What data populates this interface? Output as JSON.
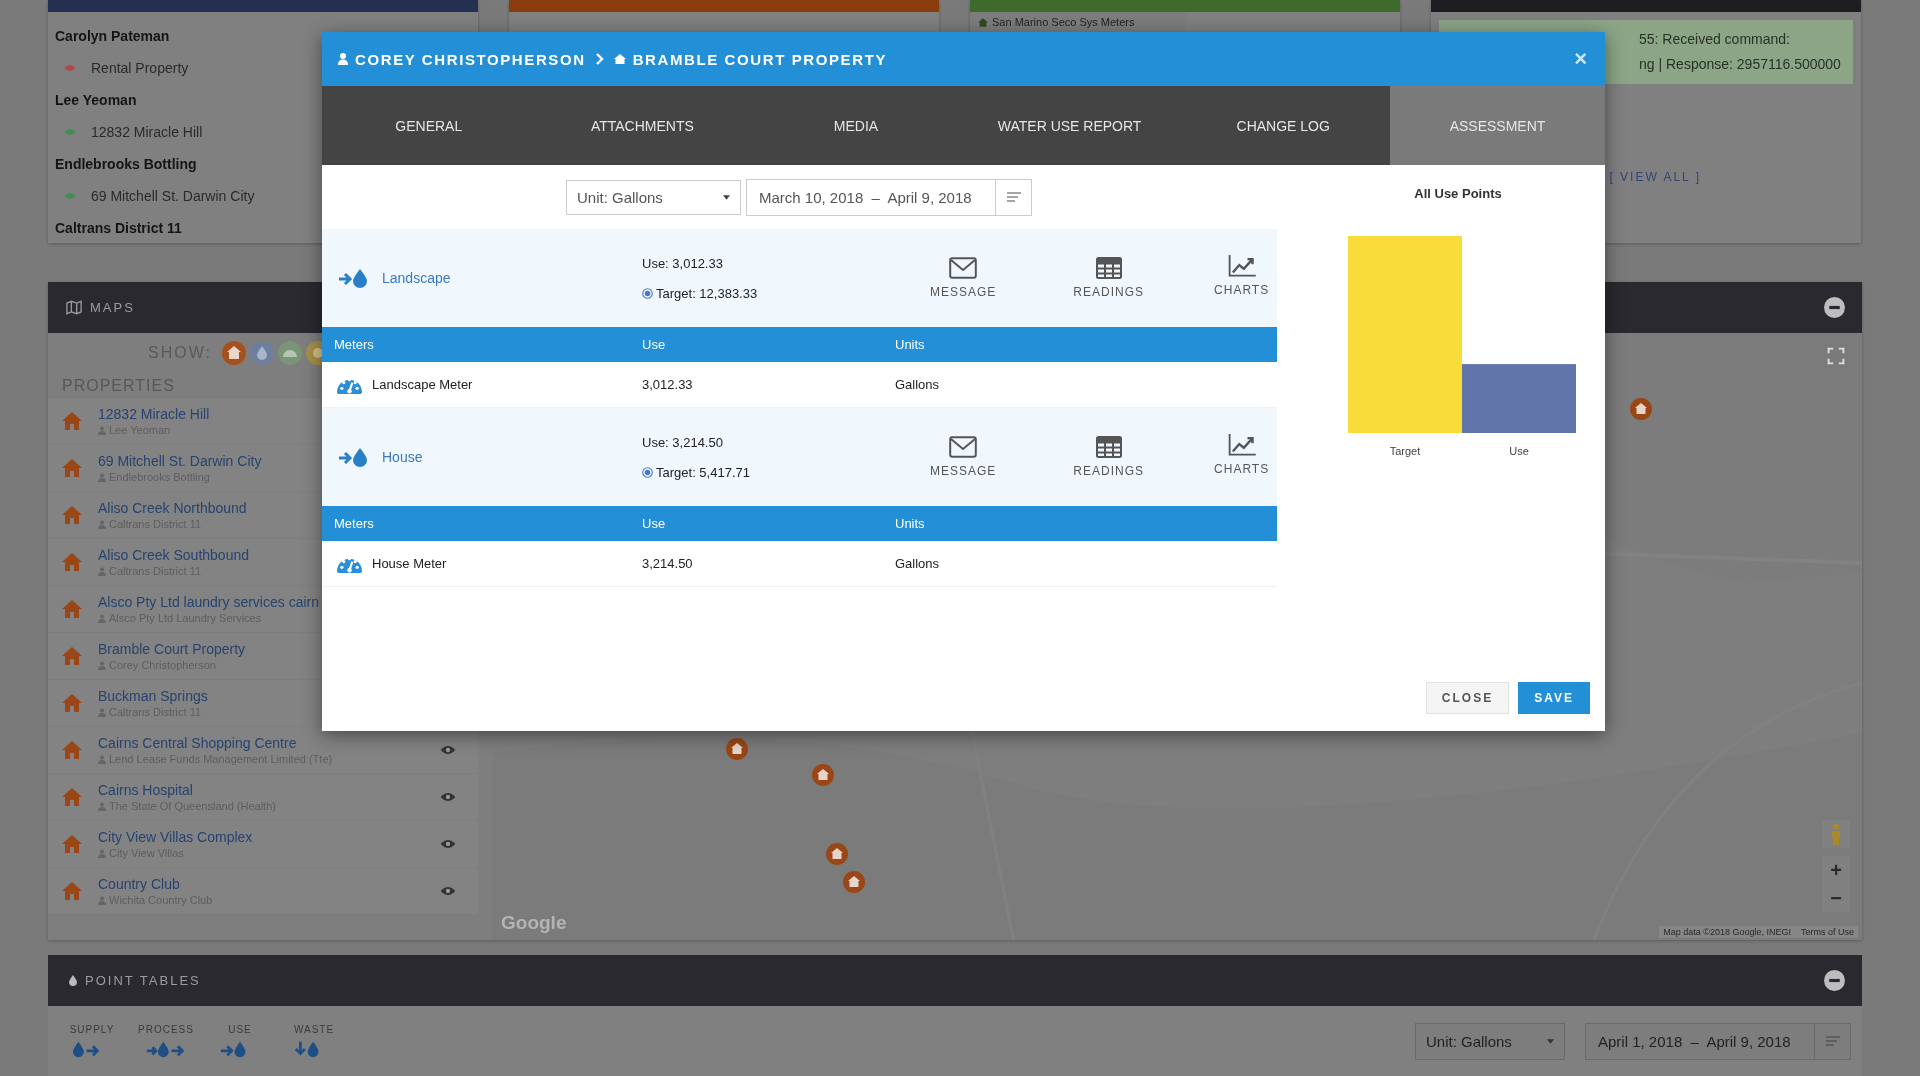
{
  "select_property": {
    "groups": [
      {
        "owner": "Carolyn Pateman",
        "properties": [
          {
            "name": "Rental Property",
            "color": "#b04848"
          }
        ]
      },
      {
        "owner": "Lee Yeoman",
        "properties": [
          {
            "name": "12832 Miracle Hill",
            "color": "#3f8f4f"
          }
        ]
      },
      {
        "owner": "Endlebrooks Bottling",
        "properties": [
          {
            "name": "69 Mitchell St. Darwin City",
            "color": "#3f8f4f"
          }
        ]
      },
      {
        "owner": "Caltrans District 11"
      }
    ]
  },
  "comparisons": {
    "items": [
      "San Marino Seco Sys Meters"
    ]
  },
  "notifications": {
    "lines": [
      "55: Received command:",
      "ng | Response: 2957116.500000"
    ],
    "view_all": "[ VIEW ALL ]"
  },
  "maps": {
    "title": "MAPS",
    "show_label": "SHOW:",
    "filters": [
      {
        "kind": "house",
        "color": "#a8501c"
      },
      {
        "kind": "drop",
        "color": "#6d7f9c"
      },
      {
        "kind": "gauge",
        "color": "#7a9478"
      },
      {
        "kind": "sun",
        "color": "#a89048"
      }
    ],
    "properties_label": "PROPERTIES",
    "properties": [
      {
        "name": "12832 Miracle Hill",
        "owner": "Lee Yeoman",
        "eye": false
      },
      {
        "name": "69 Mitchell St. Darwin City",
        "owner": "Endlebrooks Bottling",
        "eye": false
      },
      {
        "name": "Aliso Creek Northbound",
        "owner": "Caltrans District 11",
        "eye": false
      },
      {
        "name": "Aliso Creek Southbound",
        "owner": "Caltrans District 11",
        "eye": false
      },
      {
        "name": "Alsco Pty Ltd laundry services cairn",
        "owner": "Alsco Pty Ltd Laundry Services",
        "eye": false
      },
      {
        "name": "Bramble Court Property",
        "owner": "Corey Christopherson",
        "eye": false
      },
      {
        "name": "Buckman Springs",
        "owner": "Caltrans District 11",
        "eye": false
      },
      {
        "name": "Cairns Central Shopping Centre",
        "owner": "Lend Lease Funds Management Limited (Tte)",
        "eye": true
      },
      {
        "name": "Cairns Hospital",
        "owner": "The State Of Queensland (Health)",
        "eye": true
      },
      {
        "name": "City View Villas Complex",
        "owner": "City View Villas",
        "eye": true
      },
      {
        "name": "Country Club",
        "owner": "Wichita Country Club",
        "eye": true
      }
    ],
    "map": {
      "logo": "Google",
      "zoom_in": "+",
      "zoom_out": "−",
      "attribution": "Map data ©2018 Google, INEGI",
      "terms": "Terms of Use"
    }
  },
  "point_tables": {
    "title": "POINT TABLES",
    "types": [
      {
        "label": "SUPPLY",
        "kind": "supply"
      },
      {
        "label": "PROCESS",
        "kind": "process"
      },
      {
        "label": "USE",
        "kind": "use"
      },
      {
        "label": "WASTE",
        "kind": "waste"
      }
    ],
    "unit": "Unit: Gallons",
    "range": "April 1, 2018  –  April 9, 2018"
  },
  "modal": {
    "breadcrumb": [
      "COREY CHRISTOPHERSON",
      "BRAMBLE COURT PROPERTY"
    ],
    "close": "×",
    "tabs": [
      {
        "label": "GENERAL",
        "selected": false
      },
      {
        "label": "ATTACHMENTS",
        "selected": false
      },
      {
        "label": "MEDIA",
        "selected": false
      },
      {
        "label": "WATER USE REPORT",
        "selected": false
      },
      {
        "label": "CHANGE LOG",
        "selected": false
      },
      {
        "label": "ASSESSMENT",
        "selected": true
      }
    ],
    "unit": "Unit: Gallons",
    "range": "March 10, 2018  –  April 9, 2018",
    "use_points": [
      {
        "name": "Landscape",
        "use": "Use: 3,012.33",
        "target": "Target: 12,383.33",
        "actions": [
          {
            "label": "MESSAGE",
            "kind": "message"
          },
          {
            "label": "READINGS",
            "kind": "readings"
          },
          {
            "label": "CHARTS",
            "kind": "charts"
          }
        ],
        "columns": [
          "Meters",
          "Use",
          "Units"
        ],
        "meters": [
          {
            "name": "Landscape Meter",
            "use": "3,012.33",
            "units": "Gallons"
          }
        ]
      },
      {
        "name": "House",
        "use": "Use: 3,214.50",
        "target": "Target: 5,417.71",
        "actions": [
          {
            "label": "MESSAGE",
            "kind": "message"
          },
          {
            "label": "READINGS",
            "kind": "readings"
          },
          {
            "label": "CHARTS",
            "kind": "charts"
          }
        ],
        "columns": [
          "Meters",
          "Use",
          "Units"
        ],
        "meters": [
          {
            "name": "House Meter",
            "use": "3,214.50",
            "units": "Gallons"
          }
        ]
      }
    ],
    "chart": {
      "title": "All Use Points",
      "bars": [
        {
          "label": "Target",
          "kind": "target",
          "color": "#f8dd3a"
        },
        {
          "label": "Use",
          "kind": "use",
          "color": "#6275ab"
        }
      ]
    },
    "buttons": [
      {
        "label": "CLOSE",
        "kind": "secondary"
      },
      {
        "label": "SAVE",
        "kind": "primary"
      }
    ]
  }
}
